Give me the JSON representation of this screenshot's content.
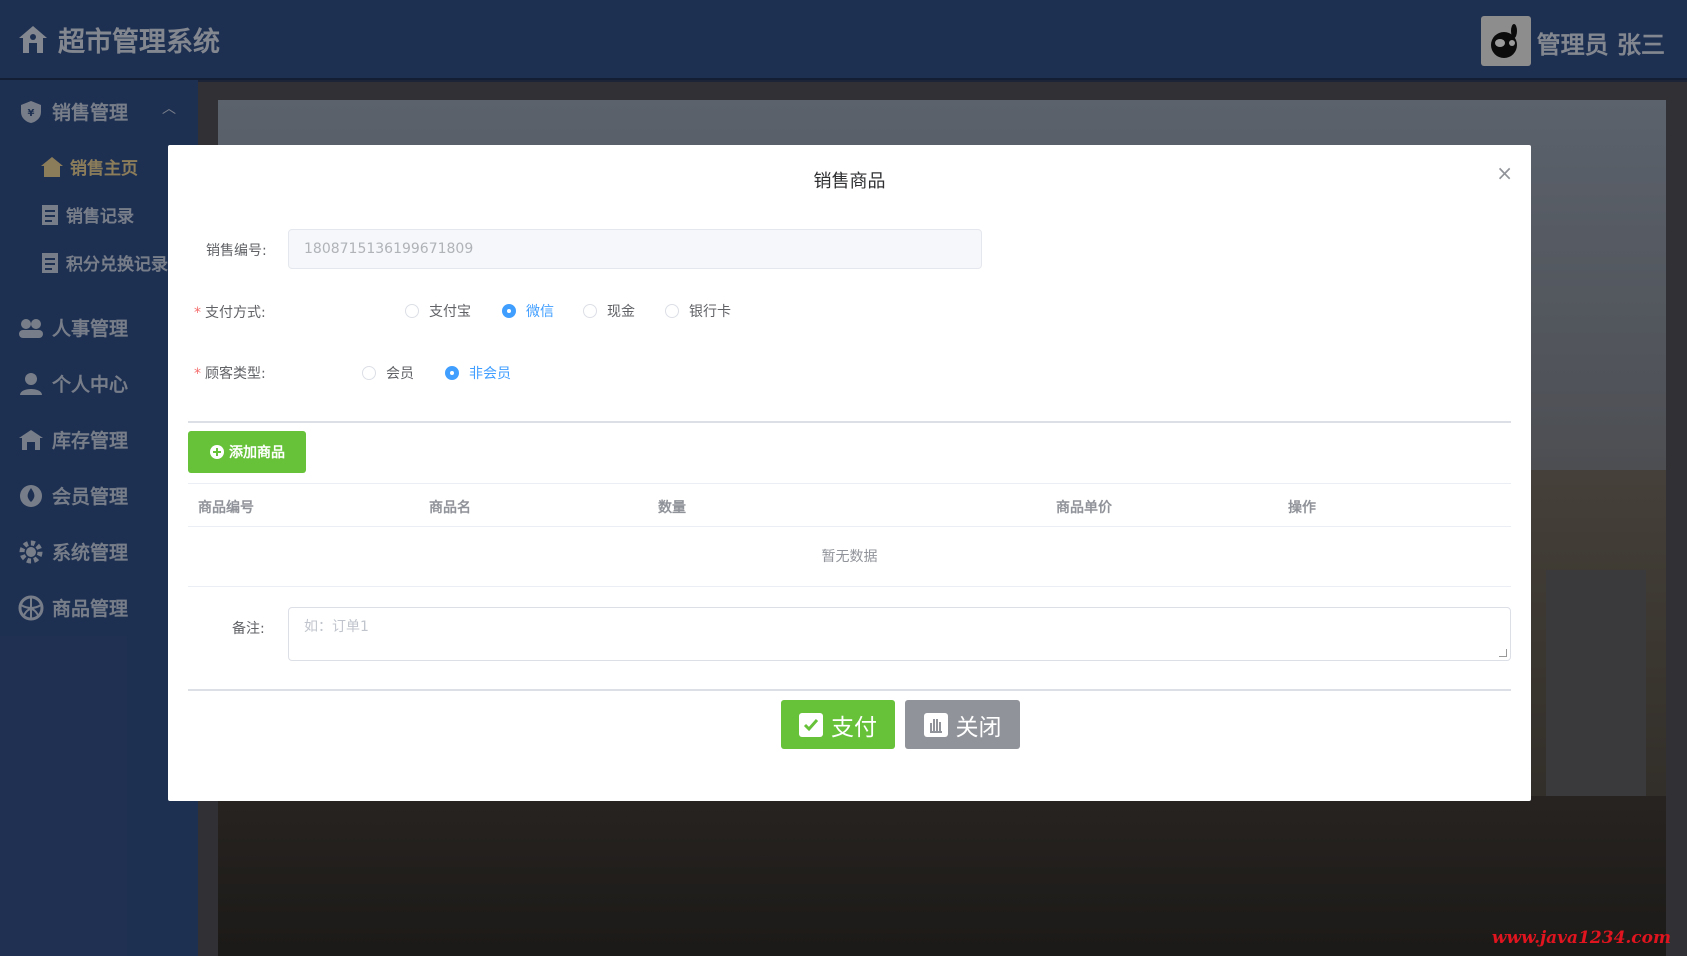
{
  "app": {
    "title": "超市管理系统"
  },
  "user": {
    "name": "管理员 张三"
  },
  "sidebar": {
    "groups": [
      {
        "label": "销售管理",
        "icon": "shield-icon"
      },
      {
        "label": "人事管理",
        "icon": "users-icon"
      },
      {
        "label": "个人中心",
        "icon": "user-icon"
      },
      {
        "label": "库存管理",
        "icon": "warehouse-icon"
      },
      {
        "label": "会员管理",
        "icon": "drop-icon"
      },
      {
        "label": "系统管理",
        "icon": "gear-icon"
      },
      {
        "label": "商品管理",
        "icon": "dribbble-icon"
      }
    ],
    "sub_items": [
      {
        "label": "销售主页",
        "icon": "home-icon",
        "active": true
      },
      {
        "label": "销售记录",
        "icon": "document-icon"
      },
      {
        "label": "积分兑换记录",
        "icon": "document-icon"
      }
    ]
  },
  "modal": {
    "title": "销售商品",
    "close_label": "×",
    "sale_no": {
      "label": "销售编号:",
      "value": "1808715136199671809"
    },
    "payment": {
      "label": "支付方式:",
      "options": [
        "支付宝",
        "微信",
        "现金",
        "银行卡"
      ],
      "selected": "微信"
    },
    "customer": {
      "label": "顾客类型:",
      "options": [
        "会员",
        "非会员"
      ],
      "selected": "非会员"
    },
    "add_button": "添加商品",
    "table": {
      "columns": [
        "商品编号",
        "商品名",
        "数量",
        "商品单价",
        "操作"
      ],
      "empty_text": "暂无数据"
    },
    "remark": {
      "label": "备注:",
      "placeholder": "如：订单1"
    },
    "pay_button": "支付",
    "close_button": "关闭"
  },
  "watermark": "www.java1234.com",
  "colors": {
    "header": "#2f4a7e",
    "success": "#67c23a",
    "info": "#909399",
    "primary": "#409eff"
  }
}
